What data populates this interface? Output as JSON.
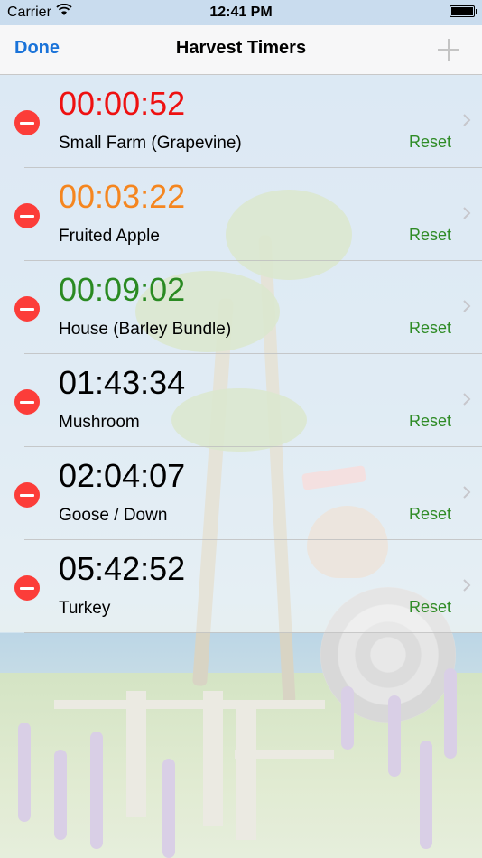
{
  "status_bar": {
    "carrier": "Carrier",
    "time": "12:41 PM"
  },
  "nav_bar": {
    "done_label": "Done",
    "title": "Harvest Timers",
    "add_icon": "plus-icon"
  },
  "colors": {
    "tint": "#1a73d9",
    "delete": "#fc3d39",
    "reset": "#2e8b25",
    "timer_red": "#ee1111",
    "timer_orange": "#f5861f",
    "timer_green": "#2a8a22",
    "timer_black": "#000000"
  },
  "timers": [
    {
      "time": "00:00:52",
      "name": "Small Farm (Grapevine)",
      "reset": "Reset",
      "color": "#ee1111"
    },
    {
      "time": "00:03:22",
      "name": "Fruited Apple",
      "reset": "Reset",
      "color": "#f5861f"
    },
    {
      "time": "00:09:02",
      "name": "House (Barley Bundle)",
      "reset": "Reset",
      "color": "#2a8a22"
    },
    {
      "time": "01:43:34",
      "name": "Mushroom",
      "reset": "Reset",
      "color": "#000000"
    },
    {
      "time": "02:04:07",
      "name": "Goose / Down",
      "reset": "Reset",
      "color": "#000000"
    },
    {
      "time": "05:42:52",
      "name": "Turkey",
      "reset": "Reset",
      "color": "#000000"
    }
  ]
}
